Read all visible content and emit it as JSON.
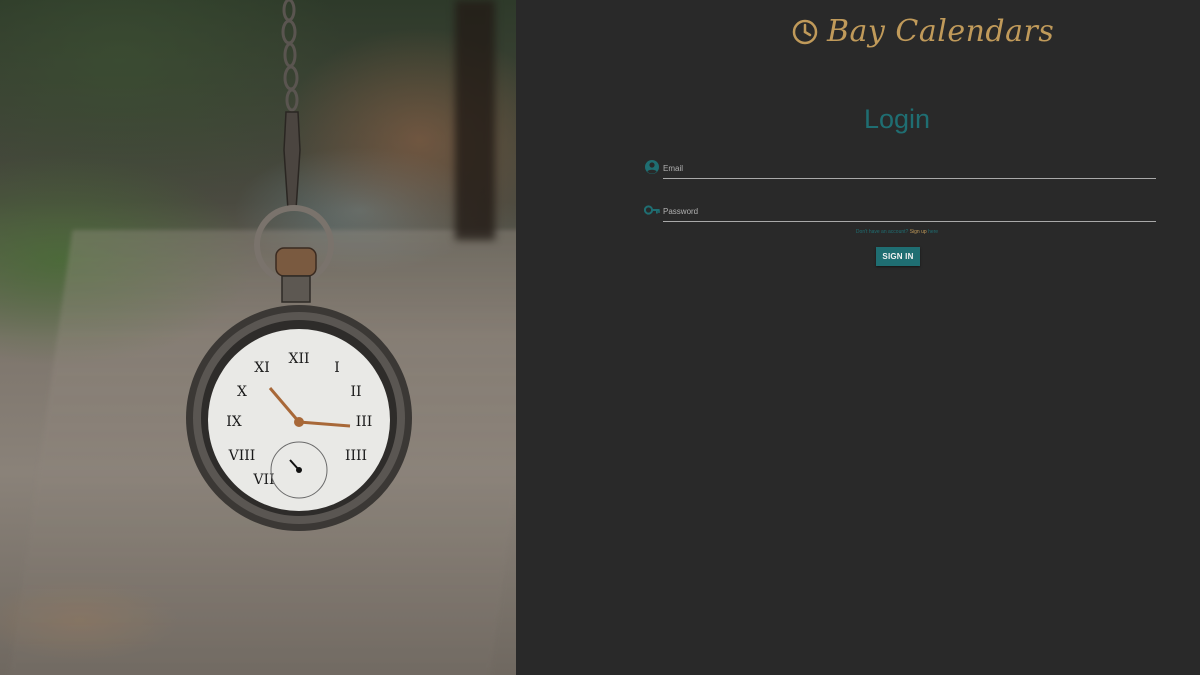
{
  "brand": {
    "name": "Bay Calendars",
    "icon": "clock-icon",
    "color": "#c09a5a"
  },
  "login": {
    "title": "Login",
    "title_color": "#1f6e72",
    "email": {
      "icon": "user-circle-icon",
      "placeholder": "Email",
      "value": ""
    },
    "password": {
      "icon": "key-icon",
      "placeholder": "Password",
      "value": ""
    },
    "signup_prompt": {
      "before": "Don't have an account?",
      "link": "Sign up",
      "after": "here"
    },
    "submit_label": "SIGN IN",
    "accent_color": "#1f6e72"
  },
  "photo": {
    "subject": "pocket-watch-image"
  }
}
